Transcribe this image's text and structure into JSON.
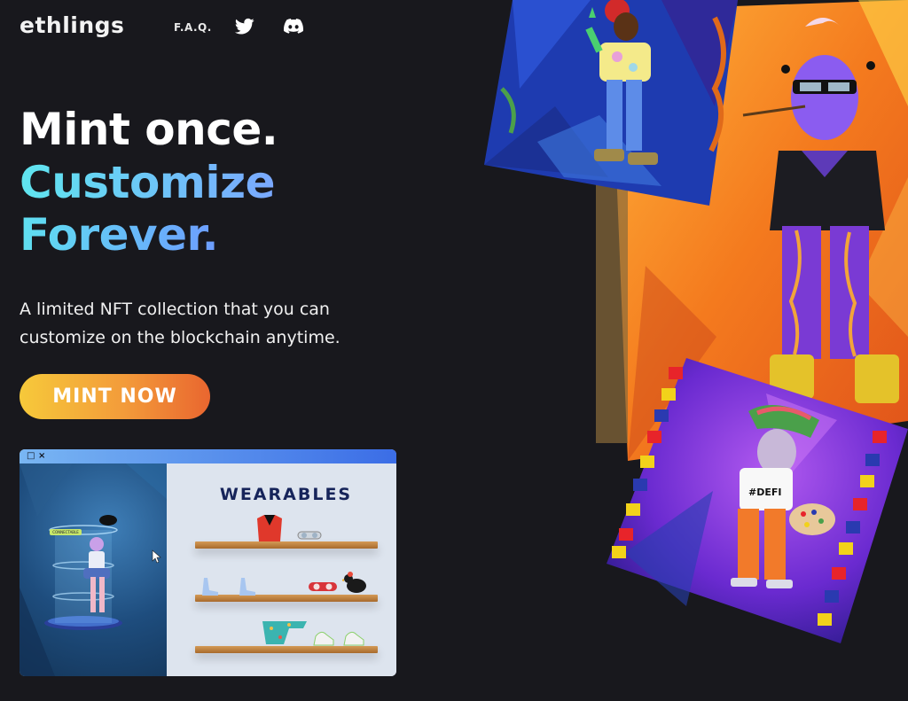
{
  "nav": {
    "logo": "ethlings",
    "faq": "F.A.Q.",
    "twitter_icon": "twitter-icon",
    "discord_icon": "discord-icon"
  },
  "hero": {
    "line1": "Mint once.",
    "line2": "Customize",
    "line3": "Forever.",
    "subtitle": "A limited NFT collection that you can customize on the blockchain anytime.",
    "cta": "MINT NOW"
  },
  "preview": {
    "title": "WEARABLES",
    "badge": "CONNECTABLE",
    "controls": [
      "□",
      "×"
    ]
  },
  "artwork": {
    "card3_shirt": "#DEFI"
  },
  "colors": {
    "background": "#18181d",
    "accent_cyan": "#5fe6ef",
    "accent_blue": "#6d9cff",
    "cta_start": "#f6c93a",
    "cta_end": "#e9662f"
  }
}
